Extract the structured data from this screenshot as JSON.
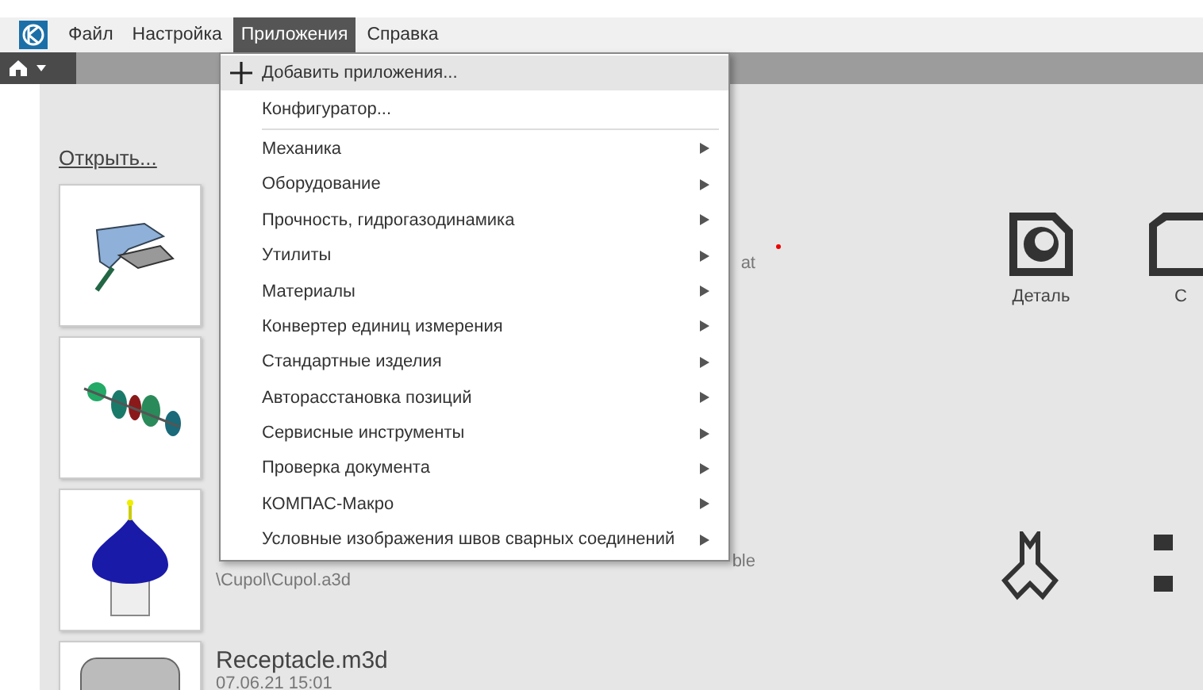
{
  "menubar": [
    {
      "label": "Файл",
      "selected": false
    },
    {
      "label": "Настройка",
      "selected": false
    },
    {
      "label": "Приложения",
      "selected": true
    },
    {
      "label": "Справка",
      "selected": false
    }
  ],
  "menu": [
    {
      "kind": "add",
      "label": "Добавить приложения...",
      "selected": true
    },
    {
      "kind": "action",
      "label": "Конфигуратор...",
      "selected": false
    },
    {
      "kind": "separator"
    },
    {
      "kind": "submenu",
      "label": "Механика",
      "selected": false
    },
    {
      "kind": "submenu",
      "label": "Оборудование",
      "selected": false
    },
    {
      "kind": "submenu",
      "label": "Прочность, гидрогазодинамика",
      "selected": false
    },
    {
      "kind": "submenu",
      "label": "Утилиты",
      "selected": false
    },
    {
      "kind": "submenu",
      "label": "Материалы",
      "selected": false
    },
    {
      "kind": "submenu",
      "label": "Конвертер единиц измерения",
      "selected": false
    },
    {
      "kind": "submenu",
      "label": "Стандартные изделия",
      "selected": false
    },
    {
      "kind": "submenu",
      "label": "Авторасстановка позиций",
      "selected": false
    },
    {
      "kind": "submenu",
      "label": "Сервисные инструменты",
      "selected": false
    },
    {
      "kind": "submenu",
      "label": "Проверка документа",
      "selected": false
    },
    {
      "kind": "submenu",
      "label": "КОМПАС-Макро",
      "selected": false
    },
    {
      "kind": "submenu",
      "label": "Условные изображения швов сварных соединений",
      "selected": false
    }
  ],
  "open_link": "Открыть...",
  "recent": [
    {
      "kind": "mechanism",
      "lines": [
        {
          "text": "at",
          "kind": "tail"
        }
      ]
    },
    {
      "kind": "gears"
    },
    {
      "kind": "dome",
      "lines": [
        {
          "text": "ble",
          "kind": "tail"
        },
        {
          "text": "\\Cupol\\Cupol.a3d",
          "kind": "path"
        }
      ]
    },
    {
      "kind": "receptacle",
      "title": "Receptacle.m3d",
      "lines": [
        {
          "text": "07.06.21 15:01",
          "kind": "path"
        }
      ]
    }
  ],
  "create": [
    {
      "label": "Деталь"
    },
    {
      "label": "С"
    }
  ]
}
